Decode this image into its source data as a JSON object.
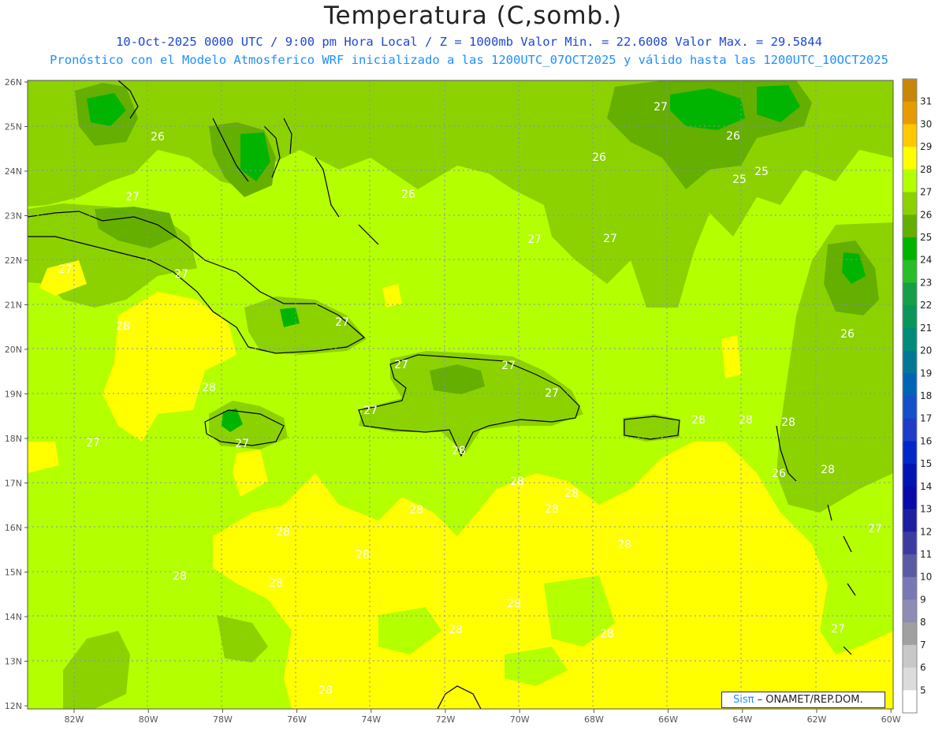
{
  "title": "Temperatura (C,somb.)",
  "subtitle_line1": "10-Oct-2025  0000 UTC / 9:00 pm Hora Local / Z = 1000mb   Valor Min. = 22.6008  Valor Max. = 29.5844",
  "subtitle_line2": "Pronóstico con el Modelo Atmosferico WRF inicializado a las 1200UTC_07OCT2025 y válido hasta las  1200UTC_10OCT2025",
  "credit": {
    "brand": "Sisπ",
    "text": " – ONAMET/REP.DOM."
  },
  "axes": {
    "lat_labels": [
      "26N",
      "25N",
      "24N",
      "23N",
      "22N",
      "21N",
      "20N",
      "19N",
      "18N",
      "17N",
      "16N",
      "15N",
      "14N",
      "13N",
      "12N"
    ],
    "lon_labels": [
      "82W",
      "80W",
      "78W",
      "76W",
      "74W",
      "72W",
      "70W",
      "68W",
      "66W",
      "64W",
      "62W",
      "60W"
    ]
  },
  "colorbar": {
    "labels": [
      "31",
      "30",
      "29",
      "28",
      "27",
      "26",
      "25",
      "24",
      "23",
      "22",
      "21",
      "20",
      "19",
      "18",
      "17",
      "16",
      "15",
      "14",
      "13",
      "12",
      "11",
      "10",
      "9",
      "8",
      "7",
      "6",
      "5"
    ],
    "colors": [
      "#c8860a",
      "#e69c00",
      "#ffc800",
      "#ffff00",
      "#b4ff00",
      "#8cd200",
      "#64af00",
      "#00b400",
      "#28be28",
      "#14a046",
      "#0a965a",
      "#008c78",
      "#007896",
      "#0064b4",
      "#1450c8",
      "#1e3cc8",
      "#0028c8",
      "#0014b4",
      "#0a0aaa",
      "#1e1ea0",
      "#3c3ca0",
      "#5a5aa5",
      "#7878b4",
      "#8c8cb4",
      "#a0a0a0",
      "#c8c8c8",
      "#dcdcdc",
      "#ffffff"
    ]
  },
  "contour_labels": [
    "26",
    "27",
    "27",
    "27",
    "26",
    "27",
    "26",
    "25",
    "25",
    "26",
    "27",
    "27",
    "27",
    "27",
    "28",
    "28",
    "27",
    "27",
    "28",
    "27",
    "27",
    "27",
    "28",
    "26",
    "26",
    "28",
    "28",
    "28",
    "28",
    "28",
    "28",
    "28",
    "28",
    "28",
    "28",
    "28",
    "28",
    "27",
    "27",
    "28",
    "28",
    "28",
    "28"
  ],
  "field_colors": {
    "c25": "#64af00",
    "c26": "#8cd200",
    "c27": "#b4ff00",
    "c28": "#ffff00",
    "c24": "#00b400"
  }
}
